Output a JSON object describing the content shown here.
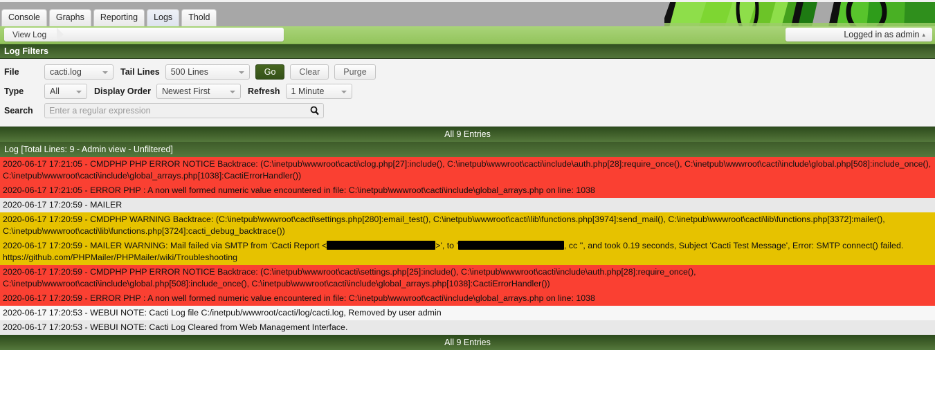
{
  "topbar": {
    "tabs": [
      {
        "label": "Console",
        "active": false
      },
      {
        "label": "Graphs",
        "active": false
      },
      {
        "label": "Reporting",
        "active": false
      },
      {
        "label": "Logs",
        "active": true
      },
      {
        "label": "Thold",
        "active": false
      }
    ],
    "logo_alt": "cacti-logo-banner"
  },
  "navbar": {
    "breadcrumb": "View Log",
    "user_label": "Logged in as admin",
    "caret": "▴"
  },
  "filters": {
    "panel_title": "Log Filters",
    "file_label": "File",
    "file_value": "cacti.log",
    "tail_lines_label": "Tail Lines",
    "tail_lines_value": "500 Lines",
    "go_label": "Go",
    "clear_label": "Clear",
    "purge_label": "Purge",
    "type_label": "Type",
    "type_value": "All",
    "display_order_label": "Display Order",
    "display_order_value": "Newest First",
    "refresh_label": "Refresh",
    "refresh_value": "1 Minute",
    "search_label": "Search",
    "search_value": "",
    "search_placeholder": "Enter a regular expression"
  },
  "log": {
    "entries_bar_top": "All 9 Entries",
    "entries_bar_bottom": "All 9 Entries",
    "header": "Log [Total Lines: 9 - Admin view - Unfiltered]",
    "rows": [
      {
        "severity": "err",
        "text": "2020-06-17 17:21:05 - CMDPHP PHP ERROR NOTICE Backtrace: (C:\\inetpub\\wwwroot\\cacti\\clog.php[27]:include(), C:\\inetpub\\wwwroot\\cacti\\include\\auth.php[28]:require_once(), C:\\inetpub\\wwwroot\\cacti\\include\\global.php[508]:include_once(), C:\\inetpub\\wwwroot\\cacti\\include\\global_arrays.php[1038]:CactiErrorHandler())"
      },
      {
        "severity": "err",
        "text": "2020-06-17 17:21:05 - ERROR PHP : A non well formed numeric value encountered in file: C:\\inetpub\\wwwroot\\cacti\\include\\global_arrays.php on line: 1038"
      },
      {
        "severity": "norm1",
        "text": "2020-06-17 17:20:59 - MAILER"
      },
      {
        "severity": "warn",
        "text": "2020-06-17 17:20:59 - CMDPHP WARNING Backtrace: (C:\\inetpub\\wwwroot\\cacti\\settings.php[280]:email_test(), C:\\inetpub\\wwwroot\\cacti\\lib\\functions.php[3974]:send_mail(), C:\\inetpub\\wwwroot\\cacti\\lib\\functions.php[3372]:mailer(), C:\\inetpub\\wwwroot\\cacti\\lib\\functions.php[3724]:cacti_debug_backtrace())"
      },
      {
        "severity": "warn",
        "redacted": true,
        "segments": [
          {
            "kind": "text",
            "value": "2020-06-17 17:20:59 - MAILER WARNING: Mail failed via SMTP from 'Cacti Report <"
          },
          {
            "kind": "redaction",
            "width": 157
          },
          {
            "kind": "text",
            "value": ">', to '"
          },
          {
            "kind": "redaction",
            "width": 153
          },
          {
            "kind": "text",
            "value": ", cc '', and took 0.19 seconds, Subject 'Cacti Test Message', Error: SMTP connect() failed. https://github.com/PHPMailer/PHPMailer/wiki/Troubleshooting"
          }
        ]
      },
      {
        "severity": "err",
        "text": "2020-06-17 17:20:59 - CMDPHP PHP ERROR NOTICE Backtrace: (C:\\inetpub\\wwwroot\\cacti\\settings.php[25]:include(), C:\\inetpub\\wwwroot\\cacti\\include\\auth.php[28]:require_once(), C:\\inetpub\\wwwroot\\cacti\\include\\global.php[508]:include_once(), C:\\inetpub\\wwwroot\\cacti\\include\\global_arrays.php[1038]:CactiErrorHandler())"
      },
      {
        "severity": "err",
        "text": "2020-06-17 17:20:59 - ERROR PHP : A non well formed numeric value encountered in file: C:\\inetpub\\wwwroot\\cacti\\include\\global_arrays.php on line: 1038"
      },
      {
        "severity": "norm2",
        "text": "2020-06-17 17:20:53 - WEBUI NOTE: Cacti Log file C:/inetpub/wwwroot/cacti/log/cacti.log, Removed by user admin"
      },
      {
        "severity": "norm1",
        "text": "2020-06-17 17:20:53 - WEBUI NOTE: Cacti Log Cleared from Web Management Interface."
      }
    ]
  },
  "colors": {
    "error_row": "#fa4032",
    "warn_row": "#e6c200",
    "header_green": "#44642d",
    "nav_green": "#9ccc68",
    "go_button": "#3d5a1c"
  }
}
